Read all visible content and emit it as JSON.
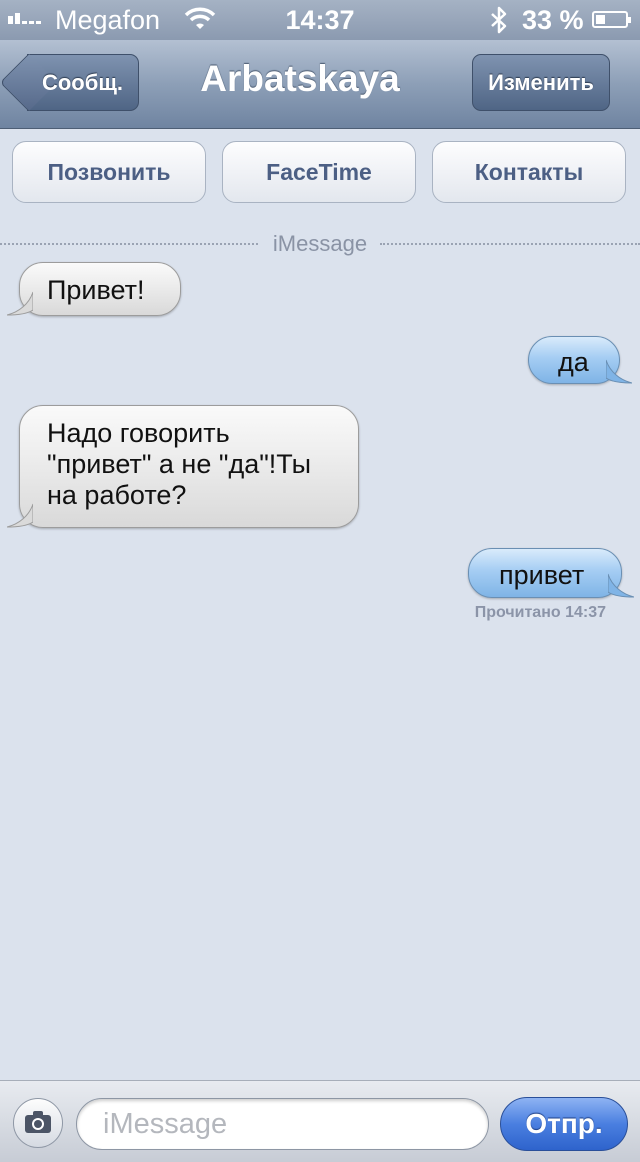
{
  "status_bar": {
    "carrier": "Megafon",
    "time": "14:37",
    "battery_percent": "33 %",
    "battery_level": 0.33,
    "icons": [
      "signal-bars-icon",
      "wifi-icon",
      "bluetooth-icon",
      "battery-icon"
    ]
  },
  "nav": {
    "back_label": "Сообщ.",
    "title": "Arbatskaya",
    "edit_label": "Изменить"
  },
  "actions": {
    "call_label": "Позвонить",
    "facetime_label": "FaceTime",
    "contacts_label": "Контакты"
  },
  "conversation": {
    "service_label": "iMessage",
    "messages": [
      {
        "direction": "incoming",
        "text": "Привет!"
      },
      {
        "direction": "outgoing",
        "text": "да"
      },
      {
        "direction": "incoming",
        "text": "Надо говорить \"привет\" а не \"да\"!Ты на работе?"
      },
      {
        "direction": "outgoing",
        "text": "привет"
      }
    ],
    "read_receipt": "Прочитано 14:37"
  },
  "composer": {
    "placeholder": "iMessage",
    "value": "",
    "send_label": "Отпр."
  },
  "colors": {
    "background": "#dbe2ed",
    "nav_bar": "#8d9fb7",
    "incoming_bubble": "#e6e6e6",
    "outgoing_bubble": "#a5cdf3",
    "send_button": "#3f74d9"
  }
}
